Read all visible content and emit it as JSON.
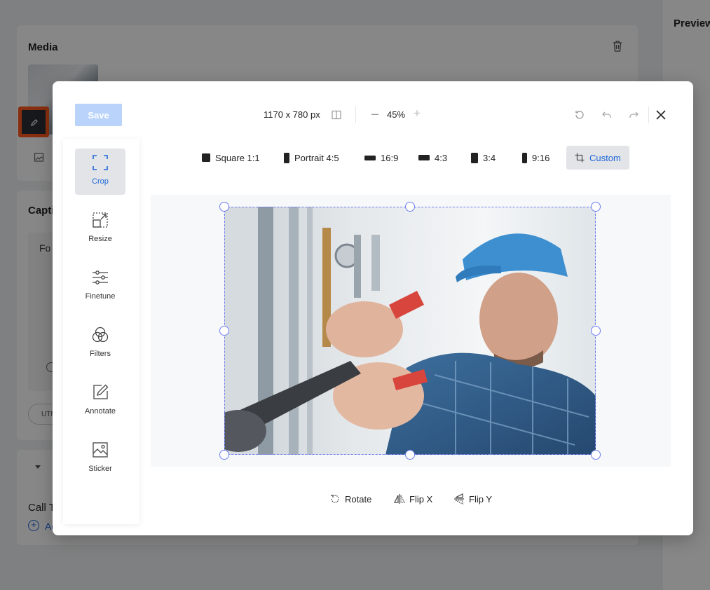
{
  "background": {
    "media_title": "Media",
    "caption_title": "Capti",
    "caption_text": "Fo",
    "utm_label": "UTM",
    "cta_title": "Call T",
    "cta_add_label": "Ad",
    "preview_title": "Preview"
  },
  "editor": {
    "save_label": "Save",
    "dimensions": "1170 x 780 px",
    "zoom": "45%",
    "tools": [
      {
        "label": "Crop",
        "icon": "crop-icon",
        "active": true
      },
      {
        "label": "Resize",
        "icon": "resize-icon",
        "active": false
      },
      {
        "label": "Finetune",
        "icon": "sliders-icon",
        "active": false
      },
      {
        "label": "Filters",
        "icon": "filters-icon",
        "active": false
      },
      {
        "label": "Annotate",
        "icon": "pencil-icon",
        "active": false
      },
      {
        "label": "Sticker",
        "icon": "sticker-icon",
        "active": false
      }
    ],
    "ratios": [
      {
        "label": "Square 1:1"
      },
      {
        "label": "Portrait 4:5"
      },
      {
        "label": "16:9"
      },
      {
        "label": "4:3"
      },
      {
        "label": "3:4"
      },
      {
        "label": "9:16"
      },
      {
        "label": "Custom"
      }
    ],
    "transforms": {
      "rotate": "Rotate",
      "flip_x": "Flip X",
      "flip_y": "Flip Y"
    },
    "colors": {
      "accent": "#1d66d8",
      "crop_frame": "#6d7ef0",
      "save_disabled": "#b9d3fb",
      "highlight": "#ff5a1f"
    }
  }
}
